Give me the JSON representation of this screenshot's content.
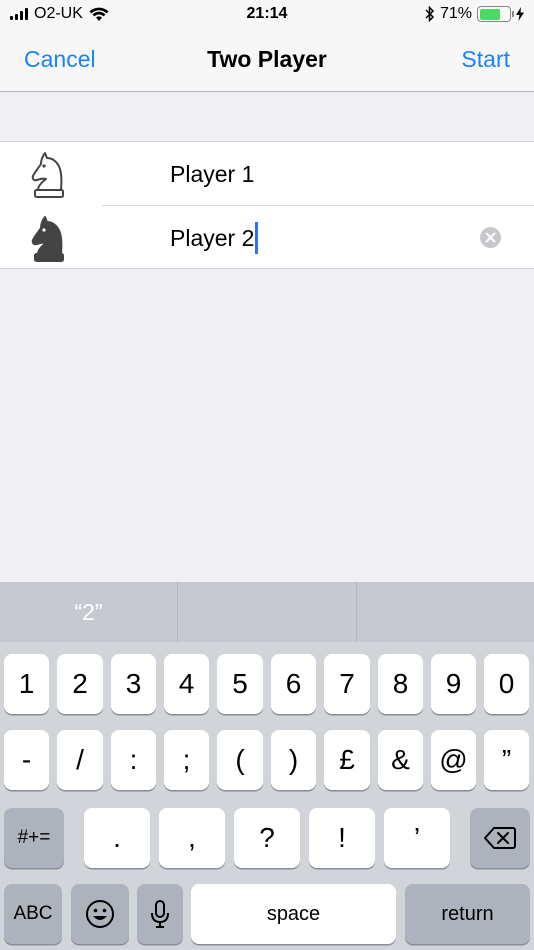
{
  "status_bar": {
    "carrier": "O2-UK",
    "time": "21:14",
    "battery_percent": "71%",
    "battery_level": 0.71
  },
  "nav": {
    "cancel_label": "Cancel",
    "title": "Two Player",
    "start_label": "Start"
  },
  "players": [
    {
      "piece": "white-knight-icon",
      "value": "Player 1"
    },
    {
      "piece": "black-knight-icon",
      "value": "Player 2"
    }
  ],
  "keyboard": {
    "suggestion": "“2”",
    "row1": [
      "1",
      "2",
      "3",
      "4",
      "5",
      "6",
      "7",
      "8",
      "9",
      "0"
    ],
    "row2": [
      "-",
      "/",
      ":",
      ";",
      "(",
      ")",
      "£",
      "&",
      "@",
      "”"
    ],
    "row3_mode": "#+=",
    "row3": [
      ".",
      ",",
      "?",
      "!",
      "’"
    ],
    "abc_label": "ABC",
    "space_label": "space",
    "return_label": "return"
  },
  "colors": {
    "accent": "#1a82fb",
    "battery": "#4cd964"
  }
}
